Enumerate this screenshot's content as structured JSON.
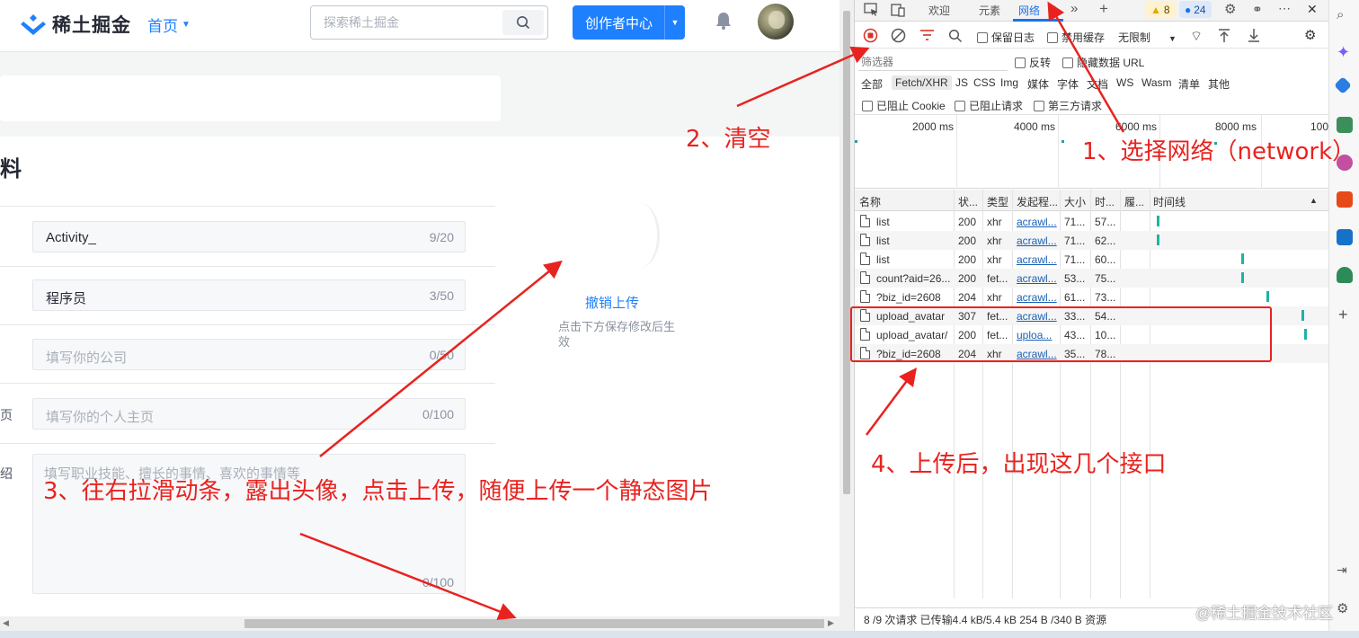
{
  "site": {
    "logo_text": "稀土掘金",
    "nav_home": "首页",
    "search_placeholder": "探索稀土掘金",
    "creator_button": "创作者中心",
    "section_title": "料",
    "fields": [
      {
        "value": "Activity_",
        "placeholder": "",
        "count": "9/20",
        "label": ""
      },
      {
        "value": "程序员",
        "placeholder": "",
        "count": "3/50",
        "label": ""
      },
      {
        "value": "",
        "placeholder": "填写你的公司",
        "count": "0/50",
        "label": ""
      },
      {
        "value": "",
        "placeholder": "填写你的个人主页",
        "count": "0/100",
        "label": "页"
      }
    ],
    "textarea": {
      "placeholder": "填写职业技能、擅长的事情、喜欢的事情等",
      "count": "0/100",
      "label": "绍"
    },
    "undo_upload": "撤销上传",
    "save_hint": "点击下方保存修改后生效"
  },
  "devtools": {
    "tabs": [
      "欢迎",
      "元素",
      "网络"
    ],
    "active_tab": "网络",
    "warn_count": "8",
    "msg_count": "24",
    "toolbar": {
      "preserve_log": "保留日志",
      "disable_cache": "禁用缓存",
      "throttle": "无限制"
    },
    "filter_placeholder": "筛选器",
    "invert": "反转",
    "hide_data_url": "隐藏数据 URL",
    "types": [
      "全部",
      "Fetch/XHR",
      "JS",
      "CSS",
      "Img",
      "媒体",
      "字体",
      "文档",
      "WS",
      "Wasm",
      "清单",
      "其他"
    ],
    "active_type": "Fetch/XHR",
    "blocked_cookie": "已阻止 Cookie",
    "blocked_requests": "已阻止请求",
    "third_party": "第三方请求",
    "overview_ticks": [
      "2000 ms",
      "4000 ms",
      "6000 ms",
      "8000 ms",
      "100"
    ],
    "columns": [
      "名称",
      "状...",
      "类型",
      "发起程...",
      "大小",
      "时...",
      "履...",
      "时间线"
    ],
    "rows": [
      {
        "name": "list",
        "status": "200",
        "type": "xhr",
        "initiator": "acrawl...",
        "size": "71...",
        "time": "57..."
      },
      {
        "name": "list",
        "status": "200",
        "type": "xhr",
        "initiator": "acrawl...",
        "size": "71...",
        "time": "62..."
      },
      {
        "name": "list",
        "status": "200",
        "type": "xhr",
        "initiator": "acrawl...",
        "size": "71...",
        "time": "60..."
      },
      {
        "name": "count?aid=26...",
        "status": "200",
        "type": "fet...",
        "initiator": "acrawl...",
        "size": "53...",
        "time": "75..."
      },
      {
        "name": "?biz_id=2608",
        "status": "204",
        "type": "xhr",
        "initiator": "acrawl...",
        "size": "61...",
        "time": "73..."
      },
      {
        "name": "upload_avatar",
        "status": "307",
        "type": "fet...",
        "initiator": "acrawl...",
        "size": "33...",
        "time": "54..."
      },
      {
        "name": "upload_avatar/",
        "status": "200",
        "type": "fet...",
        "initiator": "uploa...",
        "size": "43...",
        "time": "10..."
      },
      {
        "name": "?biz_id=2608",
        "status": "204",
        "type": "xhr",
        "initiator": "acrawl...",
        "size": "35...",
        "time": "78..."
      }
    ],
    "status_bar": "8 /9 次请求  已传输4.4 kB/5.4 kB  254 B /340 B 资源"
  },
  "annotations": {
    "step1": "1、选择网络（network）",
    "step2": "2、清空",
    "step3": "3、往右拉滑动条，露出头像，点击上传，随便上传一个静态图片",
    "step4": "4、上传后，出现这几个接口"
  },
  "watermark": "@稀土掘金技术社区",
  "colors": {
    "accent": "#1e80ff",
    "annotation": "#e8231f",
    "devtools_link": "#1a5fb4",
    "waterfall": "#1cb3a6"
  }
}
